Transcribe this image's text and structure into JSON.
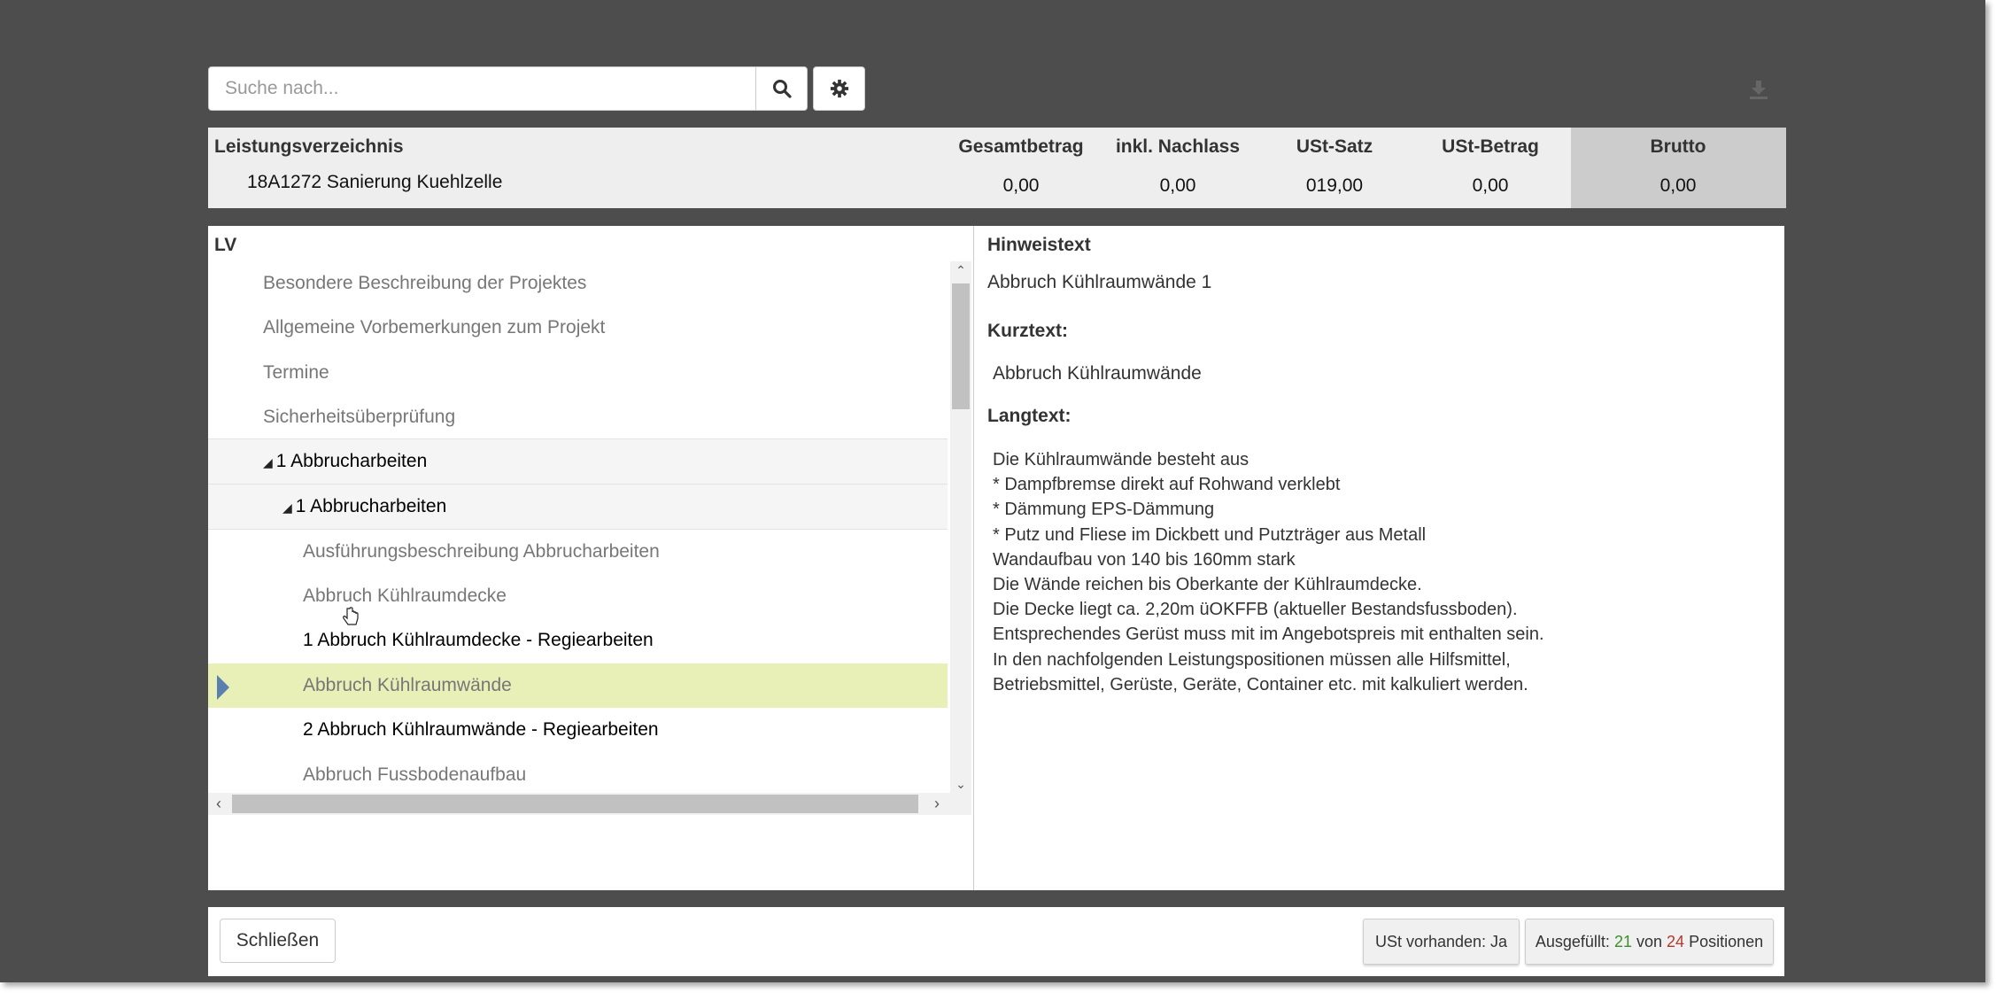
{
  "search": {
    "placeholder": "Suche nach..."
  },
  "toolbar": {
    "search_icon": "search-icon",
    "settings_icon": "gear-icon",
    "download_icon": "download-icon"
  },
  "summary": {
    "lv_label": "Leistungsverzeichnis",
    "lv_name": "18A1272 Sanierung Kuehlzelle",
    "columns": [
      {
        "label": "Gesamtbetrag",
        "value": "0,00"
      },
      {
        "label": "inkl. Nachlass",
        "value": "0,00"
      },
      {
        "label": "USt-Satz",
        "value": "019,00"
      },
      {
        "label": "USt-Betrag",
        "value": "0,00"
      },
      {
        "label": "Brutto",
        "value": "0,00"
      }
    ]
  },
  "lv": {
    "title": "LV",
    "items": [
      {
        "label": "Besondere Beschreibung der Projektes"
      },
      {
        "label": "Allgemeine Vorbemerkungen zum Projekt"
      },
      {
        "label": "Termine"
      },
      {
        "label": "Sicherheitsüberprüfung"
      },
      {
        "label": "1 Abbrucharbeiten"
      },
      {
        "label": "1 Abbrucharbeiten"
      },
      {
        "label": "Ausführungsbeschreibung Abbrucharbeiten"
      },
      {
        "label": "Abbruch Kühlraumdecke"
      },
      {
        "label": "1 Abbruch Kühlraumdecke - Regiearbeiten"
      },
      {
        "label": "Abbruch Kühlraumwände"
      },
      {
        "label": "2 Abbruch Kühlraumwände - Regiearbeiten"
      },
      {
        "label": "Abbruch Fussbodenaufbau"
      }
    ]
  },
  "detail": {
    "hinweis_label": "Hinweistext",
    "hinweis_text": "Abbruch Kühlraumwände 1",
    "kurztext_label": "Kurztext:",
    "kurztext": "Abbruch Kühlraumwände",
    "langtext_label": "Langtext:",
    "langtext": "Die Kühlraumwände besteht aus\n* Dampfbremse direkt auf Rohwand verklebt\n* Dämmung EPS-Dämmung\n* Putz und Fliese im Dickbett und Putzträger aus Metall\nWandaufbau von 140 bis 160mm stark\nDie Wände reichen bis Oberkante der Kühlraumdecke.\nDie Decke liegt ca. 2,20m üOKFFB (aktueller Bestandsfussboden).\nEntsprechendes Gerüst muss mit im Angebotspreis mit enthalten sein.\nIn den nachfolgenden Leistungspositionen müssen alle Hilfsmittel,\nBetriebsmittel, Gerüste, Geräte, Container etc. mit kalkuliert werden."
  },
  "footer": {
    "close_label": "Schließen",
    "ust_label": "USt vorhanden: Ja",
    "filled_prefix": "Ausgefüllt:",
    "filled_count": "21",
    "filled_mid": "von",
    "filled_total": "24",
    "filled_suffix": "Positionen",
    "colors": {
      "filled": "#3c8f28",
      "total": "#b23a2e",
      "selected_row": "#e8f0b8",
      "selection_marker": "#5b7fae"
    }
  }
}
